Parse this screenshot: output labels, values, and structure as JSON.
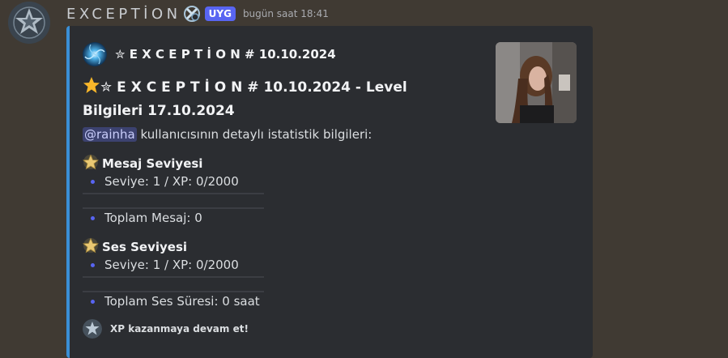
{
  "message": {
    "username": "EXCEPTİON",
    "app_tag": "UYG",
    "timestamp": "bugün saat 18:41",
    "avatar_icon": "star-emblem-avatar",
    "badge_icon": "x-shield-badge-icon"
  },
  "embed": {
    "accent_color": "#3a8fd6",
    "author_name": "✮ E X C E P T İ O N # 10.10.2024",
    "title": "✮ E X C E P T İ O N # 10.10.2024 - Level Bilgileri 17.10.2024",
    "description": {
      "mention": "@rainha",
      "text": " kullanıcısının detaylı istatistik bilgileri:"
    },
    "message_section": {
      "title": "Mesaj Seviyesi",
      "level_line": "Seviye: 1 / XP: 0/2000",
      "total_line": "Toplam Mesaj: 0"
    },
    "voice_section": {
      "title": "Ses Seviyesi",
      "level_line": "Seviye: 1 / XP: 0/2000",
      "total_line": "Toplam Ses Süresi: 0 saat"
    },
    "footer_text": "XP kazanmaya devam et!"
  },
  "colors": {
    "background": "#403a33",
    "embed_bg": "#2b2d31",
    "app_tag": "#5865f2",
    "bullet": "#5865f2",
    "mention_bg": "#3c4270"
  }
}
